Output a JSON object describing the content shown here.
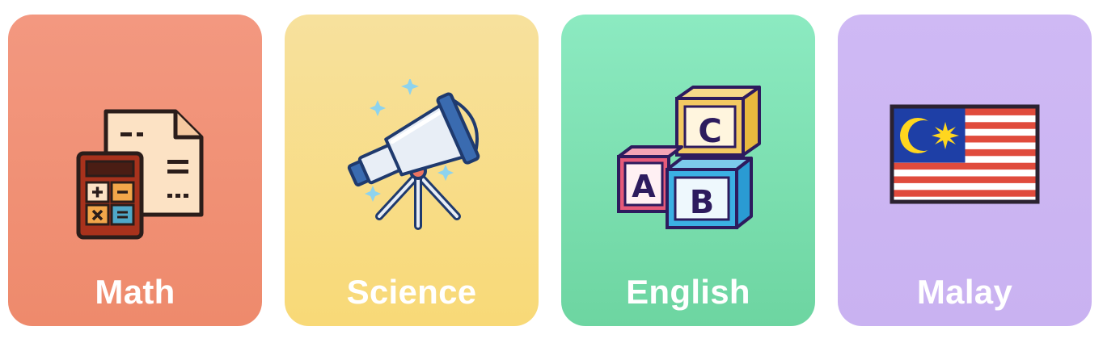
{
  "subjects": [
    {
      "label": "Math",
      "icon": "calculator-document-icon",
      "color": "#EE8A6C"
    },
    {
      "label": "Science",
      "icon": "telescope-icon",
      "color": "#F8D977"
    },
    {
      "label": "English",
      "icon": "abc-blocks-icon",
      "color": "#6DD5A1"
    },
    {
      "label": "Malay",
      "icon": "malaysia-flag-icon",
      "color": "#C9B2F1"
    }
  ],
  "block_letters": {
    "a": "A",
    "b": "B",
    "c": "C"
  }
}
